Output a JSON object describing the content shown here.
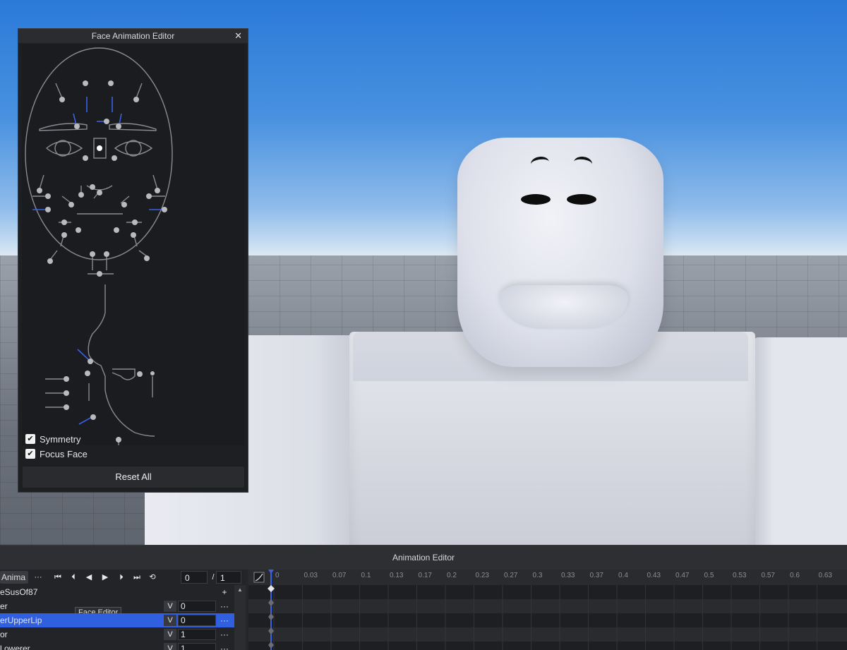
{
  "face_editor": {
    "title": "Face Animation Editor",
    "close_icon": "close-icon",
    "symmetry_label": "Symmetry",
    "symmetry_checked": true,
    "focus_face_label": "Focus Face",
    "focus_face_checked": true,
    "reset_label": "Reset All"
  },
  "animation_editor": {
    "title": "Animation Editor",
    "anim_name": "Anima",
    "more_label": "···",
    "frame_current": "0",
    "frame_separator": "/",
    "frame_total": "1",
    "tooltip": "Face Editor",
    "add_label": "+",
    "rows": [
      {
        "name": "eSusOf87",
        "has_value": false
      },
      {
        "name": "er",
        "v": "V",
        "value": "0",
        "more": "···"
      },
      {
        "name": "erUpperLip",
        "v": "V",
        "value": "0",
        "more": "···",
        "selected": true
      },
      {
        "name": "or",
        "v": "V",
        "value": "1",
        "more": "···"
      },
      {
        "name": "l owerer",
        "v": "V",
        "value": "1",
        "more": "···"
      }
    ],
    "ticks": [
      "0",
      "0.03",
      "0.07",
      "0.1",
      "0.13",
      "0.17",
      "0.2",
      "0.23",
      "0.27",
      "0.3",
      "0.33",
      "0.37",
      "0.4",
      "0.43",
      "0.47",
      "0.5",
      "0.53",
      "0.57",
      "0.6",
      "0.63"
    ],
    "accent_color": "#3060e0"
  }
}
